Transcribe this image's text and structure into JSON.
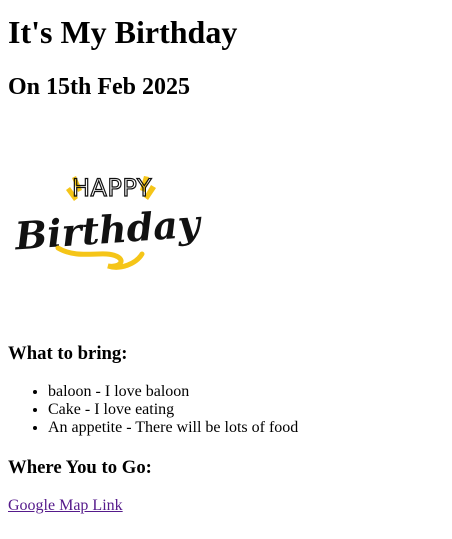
{
  "header": {
    "title": "It's My Birthday",
    "date_line": "On 15th Feb 2025"
  },
  "hero_image": {
    "top_text": "HAPPY",
    "main_text": "Birthday",
    "accent_color": "#f5c518",
    "ink_color": "#111111"
  },
  "bring": {
    "heading": "What to bring:",
    "items": [
      "baloon - I love baloon",
      "Cake - I love eating",
      "An appetite - There will be lots of food"
    ]
  },
  "where": {
    "heading": "Where You to Go:",
    "link_label": "Google Map Link",
    "link_color": "#551a8b"
  }
}
